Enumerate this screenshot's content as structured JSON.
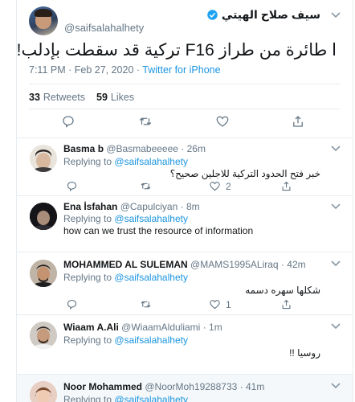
{
  "main_tweet": {
    "author_name": "سيف صلاح الهيتي",
    "handle": "@saifsalahalhety",
    "text": "ا طائرة من طراز F16 تركية قد سقطت بإدلب!",
    "time": "7:11 PM · Feb 27, 2020",
    "separator": " · ",
    "source": "Twitter for iPhone",
    "retweets_count": "33",
    "retweets_label": "Retweets",
    "likes_count": "59",
    "likes_label": "Likes"
  },
  "replies": [
    {
      "name": "Basma b",
      "handle": "@Basmabeeeee",
      "time": "· 26m",
      "replying_label": "Replying to",
      "replying_to": "@saifsalahalhety",
      "text": "خبر فتح الحدود التركية للاجلين صحيح؟",
      "reply_count": "",
      "retweet_count": "",
      "like_count": "2"
    },
    {
      "name": "Ena İsfahan",
      "handle": "@Capulciyan",
      "time": "· 8m",
      "replying_label": "Replying to",
      "replying_to": "@saifsalahalhety",
      "text": "how can we trust the resource of information",
      "reply_count": "",
      "retweet_count": "",
      "like_count": ""
    },
    {
      "name": "MOHAMMED AL SULEMAN",
      "handle": "@MAMS1995ALiraq",
      "time": "· 42m",
      "replying_label": "Replying to",
      "replying_to": "@saifsalahalhety",
      "text": "شكلها سهره دسمه",
      "reply_count": "",
      "retweet_count": "",
      "like_count": "1"
    },
    {
      "name": "Wiaam A.Ali",
      "handle": "@WiaamAlduliami",
      "time": "· 1m",
      "replying_label": "Replying to",
      "replying_to": "@saifsalahalhety",
      "text": "روسيا !!",
      "reply_count": "",
      "retweet_count": "",
      "like_count": ""
    },
    {
      "name": "Noor Mohammed",
      "handle": "@NoorMoh19288733",
      "time": "· 41m",
      "replying_label": "Replying to",
      "replying_to": "@saifsalahalhety",
      "text": "",
      "reply_count": "",
      "retweet_count": "",
      "like_count": ""
    }
  ],
  "colors": {
    "link": "#1b95e0",
    "secondary_text": "#657786",
    "border": "#e6ecf0",
    "highlight_bg": "#f5f8fa"
  },
  "icons": [
    "chevron-down-icon",
    "verified-badge-icon",
    "reply-icon",
    "retweet-icon",
    "like-icon",
    "share-icon"
  ]
}
